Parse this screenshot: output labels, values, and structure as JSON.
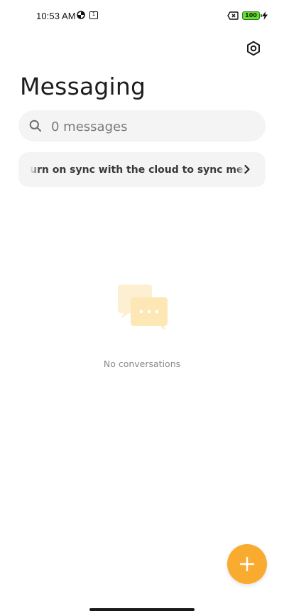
{
  "status_bar": {
    "time": "10:53 AM",
    "icons": [
      "data-saver-icon",
      "calendar-notification-icon",
      "sim-error-icon",
      "battery-icon",
      "charging-bolt-icon"
    ],
    "calendar_day": "1",
    "battery_level": "100",
    "battery_color": "#6bd83a"
  },
  "header": {
    "settings_icon": "settings-hexagon-icon",
    "title": "Messaging"
  },
  "search": {
    "icon": "search-icon",
    "placeholder": "0 messages"
  },
  "sync_banner": {
    "text": "Turn on sync with the cloud to sync messages",
    "chevron_icon": "chevron-right-icon"
  },
  "empty_state": {
    "icon": "chat-bubbles-icon",
    "accent": "#fde7b5",
    "text": "No conversations"
  },
  "fab": {
    "icon": "plus-icon",
    "color": "#f9ab2f"
  }
}
